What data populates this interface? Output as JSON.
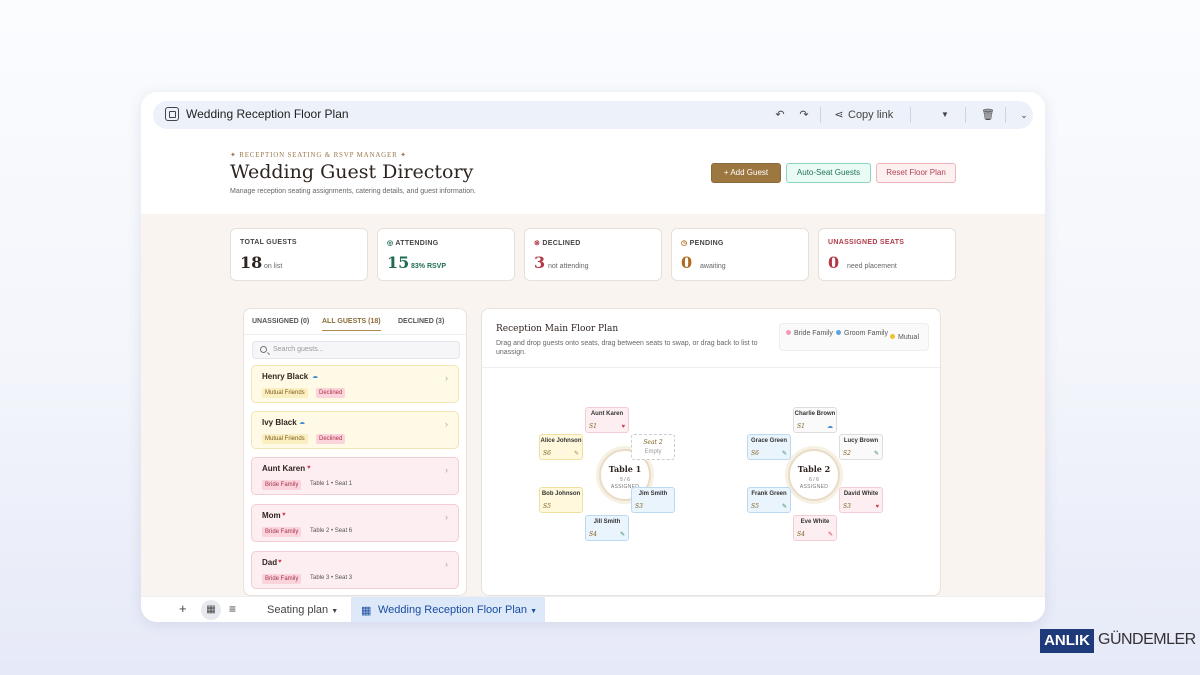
{
  "window": {
    "title": "Wedding Reception Floor Plan",
    "copy_link": "Copy link"
  },
  "header": {
    "eyebrow": "RECEPTION SEATING & RSVP MANAGER",
    "title": "Wedding Guest Directory",
    "subtitle": "Manage reception seating assignments, catering details, and guest information.",
    "add_guest": "+ Add Guest",
    "auto_seat": "Auto-Seat Guests",
    "reset_plan": "Reset Floor Plan"
  },
  "stats": [
    {
      "label": "TOTAL GUESTS",
      "value": "18",
      "note": "on list",
      "color": "#2e2520"
    },
    {
      "label": "ATTENDING",
      "value": "15",
      "note": "83% RSVP",
      "color": "#1f6b52"
    },
    {
      "label": "DECLINED",
      "value": "3",
      "note": "not attending",
      "color": "#b23a48"
    },
    {
      "label": "PENDING",
      "value": "0",
      "note": "awaiting",
      "color": "#b06a1f"
    },
    {
      "label": "UNASSIGNED SEATS",
      "value": "0",
      "note": "need placement",
      "color": "#b23a48"
    }
  ],
  "guest_panel": {
    "tabs": [
      "UNASSIGNED (0)",
      "ALL GUESTS (18)",
      "DECLINED (3)"
    ],
    "active_tab": "ALL GUESTS (18)",
    "search_placeholder": "Search guests...",
    "guests": [
      {
        "name": "Henry Black",
        "group": "Mutual Friends",
        "status": "Declined",
        "seat": ""
      },
      {
        "name": "Ivy Black",
        "group": "Mutual Friends",
        "status": "Declined",
        "seat": ""
      },
      {
        "name": "Aunt Karen",
        "group": "Bride Family",
        "status": "",
        "seat": "Table 1 • Seat 1"
      },
      {
        "name": "Mom",
        "group": "Bride Family",
        "status": "",
        "seat": "Table 2 • Seat 6"
      },
      {
        "name": "Dad",
        "group": "Bride Family",
        "status": "",
        "seat": "Table 3 • Seat 3"
      }
    ]
  },
  "floor_plan": {
    "title": "Reception Main Floor Plan",
    "subtitle": "Drag and drop guests onto seats, drag between seats to swap, or drag back to list to unassign.",
    "legend": {
      "bride": "Bride Family",
      "groom": "Groom Family",
      "mutual": "Mutual"
    },
    "colors": {
      "bride": "#f29bb1",
      "groom": "#5aa4e6",
      "mutual": "#f2c12e"
    },
    "table1": {
      "name": "Table 1",
      "count": "5 / 6",
      "status": "ASSIGNED",
      "seats": {
        "s1": {
          "name": "Aunt Karen",
          "label": "S1"
        },
        "s2": {
          "name": "Empty",
          "label": "Seat 2"
        },
        "s3": {
          "name": "Jim Smith",
          "label": "S3"
        },
        "s4": {
          "name": "Jill Smith",
          "label": "S4"
        },
        "s5": {
          "name": "Bob Johnson",
          "label": "S5"
        },
        "s6": {
          "name": "Alice Johnson",
          "label": "S6"
        }
      }
    },
    "table2": {
      "name": "Table 2",
      "count": "6 / 6",
      "status": "ASSIGNED",
      "seats": {
        "s1": {
          "name": "Charlie Brown",
          "label": "S1"
        },
        "s2": {
          "name": "Lucy Brown",
          "label": "S2"
        },
        "s3": {
          "name": "David White",
          "label": "S3"
        },
        "s4": {
          "name": "Eve White",
          "label": "S4"
        },
        "s5": {
          "name": "Frank Green",
          "label": "S5"
        },
        "s6": {
          "name": "Grace Green",
          "label": "S6"
        }
      }
    }
  },
  "bottom_bar": {
    "sheet1": "Seating plan",
    "sheet2": "Wedding Reception Floor Plan"
  },
  "brand": {
    "part1": "ANLIK",
    "part2": "GÜNDEMLER"
  }
}
